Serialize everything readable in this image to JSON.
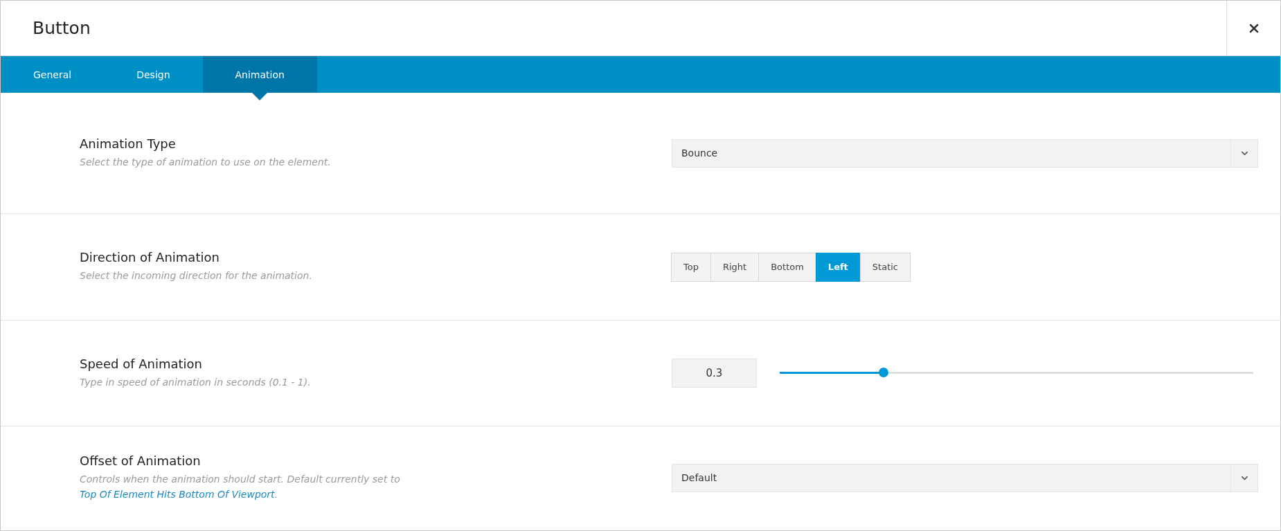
{
  "window": {
    "title": "Button"
  },
  "tabs": [
    {
      "label": "General",
      "selected": false
    },
    {
      "label": "Design",
      "selected": false
    },
    {
      "label": "Animation",
      "selected": true
    }
  ],
  "settings": [
    {
      "kind": "select",
      "label": "Animation Type",
      "description": "Select the type of animation to use on the element.",
      "value": "Bounce"
    },
    {
      "kind": "buttons",
      "label": "Direction of Animation",
      "description": "Select the incoming direction for the animation.",
      "options": [
        {
          "label": "Top",
          "selected": false
        },
        {
          "label": "Right",
          "selected": false
        },
        {
          "label": "Bottom",
          "selected": false
        },
        {
          "label": "Left",
          "selected": true
        },
        {
          "label": "Static",
          "selected": false
        }
      ]
    },
    {
      "kind": "range",
      "label": "Speed of Animation",
      "description": "Type in speed of animation in seconds (0.1 - 1).",
      "value": "0.3",
      "level": 0.22
    },
    {
      "kind": "select",
      "label": "Offset of Animation",
      "description": "Controls when the animation should start. Default currently set to ",
      "link": "Top Of Element Hits Bottom Of Viewport",
      "after_link": ".",
      "value": "Default"
    }
  ]
}
